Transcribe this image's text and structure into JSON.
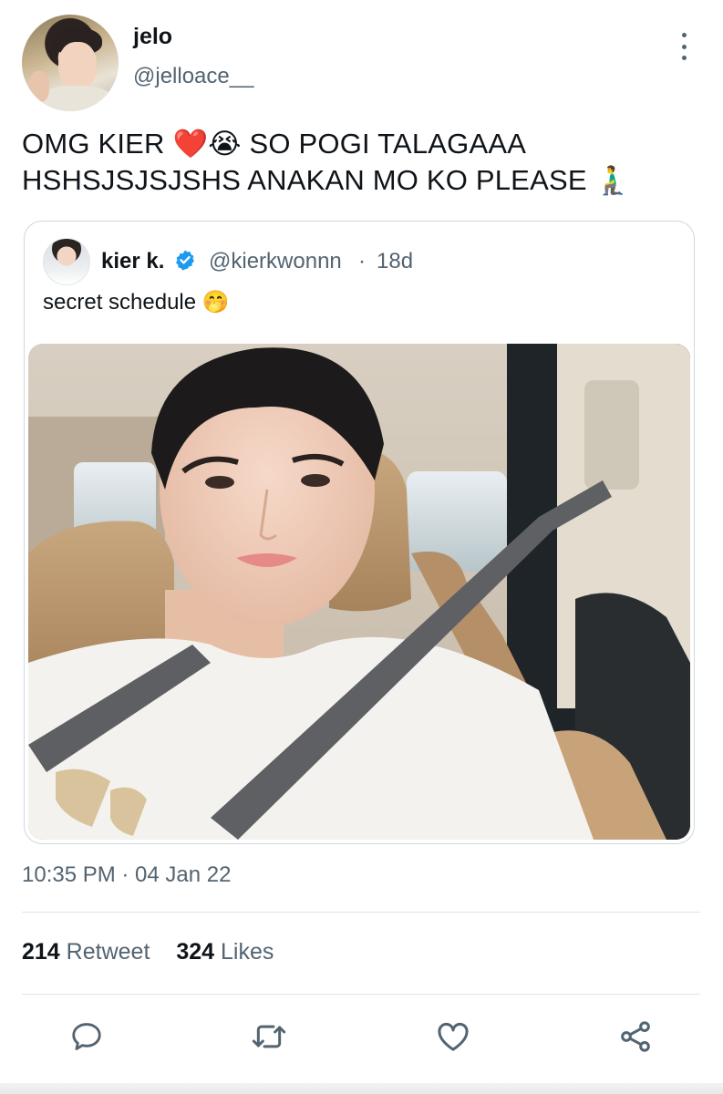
{
  "author": {
    "display_name": "jelo",
    "handle": "@jelloace__"
  },
  "tweet": {
    "text_1": "OMG KIER",
    "emoji_1": "❤️",
    "emoji_2": "😭",
    "text_2": "SO POGI TALAGAAA",
    "text_3": "HSHSJSJSJSHS ANAKAN MO KO PLEASE",
    "emoji_3": "🧎‍♂️"
  },
  "quoted_tweet": {
    "display_name": "kier k.",
    "verified": true,
    "handle": "@kierkwonnn",
    "separator": "·",
    "age": "18d",
    "text": "secret schedule",
    "emoji": "🤭"
  },
  "meta": {
    "timestamp": "10:35 PM · 04 Jan 22"
  },
  "stats": {
    "retweets_count": "214",
    "retweets_label": "Retweet",
    "likes_count": "324",
    "likes_label": "Likes"
  },
  "icons": {
    "more": "more-vertical-icon",
    "reply": "reply-icon",
    "retweet": "retweet-icon",
    "like": "heart-icon",
    "share": "share-icon",
    "verified": "verified-badge-icon"
  },
  "colors": {
    "text_primary": "#0f1419",
    "text_secondary": "#536471",
    "verified_blue": "#1d9bf0",
    "border": "#cfd9de"
  }
}
